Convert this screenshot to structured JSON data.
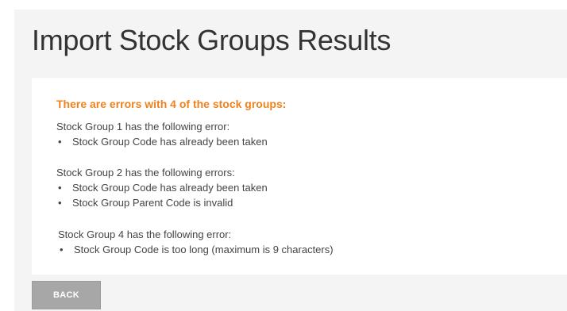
{
  "page": {
    "title": "Import Stock Groups Results"
  },
  "results": {
    "heading": "There are errors with 4 of the stock groups:",
    "groups": [
      {
        "title": "Stock Group 1 has the following error:",
        "errors": [
          "Stock Group Code has already been taken"
        ]
      },
      {
        "title": "Stock Group 2 has the following errors:",
        "errors": [
          "Stock Group Code has already been taken",
          "Stock Group Parent Code is invalid"
        ]
      },
      {
        "title": "Stock Group 4 has the following error:",
        "errors": [
          "Stock Group Code is too long (maximum is 9 characters)"
        ]
      }
    ]
  },
  "actions": {
    "back_label": "BACK"
  },
  "colors": {
    "error_heading": "#f0821e",
    "page_background": "#f4f4f4",
    "button_background": "#a7a7a7"
  }
}
